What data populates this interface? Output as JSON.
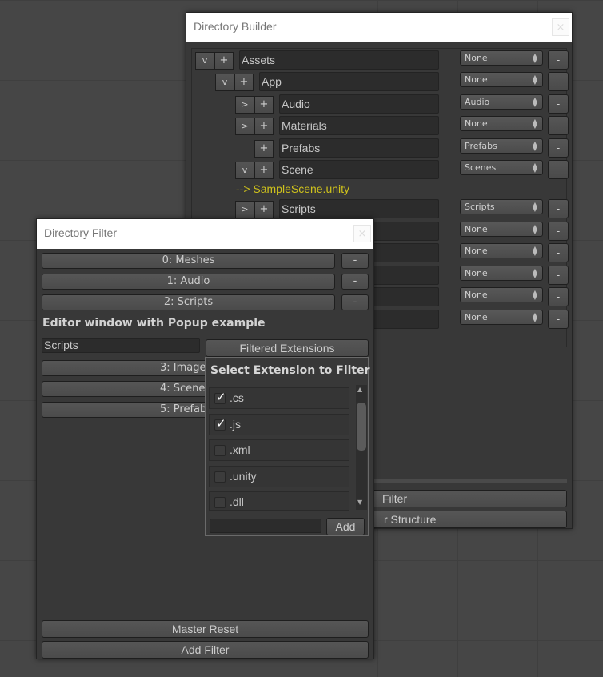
{
  "directory_builder": {
    "title": "Directory Builder",
    "close": "×",
    "tree": [
      {
        "toggle": "v",
        "add": "+",
        "name": "Assets",
        "dropdown": "None",
        "remove": "-"
      },
      {
        "toggle": "v",
        "add": "+",
        "name": "App",
        "dropdown": "None",
        "remove": "-"
      },
      {
        "toggle": ">",
        "add": "+",
        "name": "Audio",
        "dropdown": "Audio",
        "remove": "-"
      },
      {
        "toggle": ">",
        "add": "+",
        "name": "Materials",
        "dropdown": "None",
        "remove": "-"
      },
      {
        "toggle": "",
        "add": "+",
        "name": "Prefabs",
        "dropdown": "Prefabs",
        "remove": "-"
      },
      {
        "toggle": "v",
        "add": "+",
        "name": "Scene",
        "dropdown": "Scenes",
        "remove": "-"
      },
      {
        "toggle": ">",
        "add": "+",
        "name": "Scripts",
        "dropdown": "Scripts",
        "remove": "-"
      }
    ],
    "scene_file": "--> SampleScene.unity",
    "more_dropdowns": [
      "None",
      "None",
      "None",
      "None",
      "None"
    ],
    "remove_label": "-",
    "bottom_button_1": "Filter",
    "bottom_button_2": "r Structure"
  },
  "directory_filter": {
    "title": "Directory Filter",
    "close": "×",
    "filters": [
      {
        "label": "0: Meshes",
        "remove": "-"
      },
      {
        "label": "1: Audio",
        "remove": "-"
      },
      {
        "label": "2: Scripts",
        "remove": "-"
      }
    ],
    "popup_heading": "Editor window with Popup example",
    "name_field": "Scripts",
    "filtered_extensions_button": "Filtered Extensions",
    "more_filters": [
      "3: Image",
      "4: Scene",
      "5: Prefab"
    ],
    "master_reset": "Master Reset",
    "add_filter": "Add Filter"
  },
  "extension_popup": {
    "title": "Select Extension to Filter",
    "items": [
      {
        "label": ".cs",
        "checked": true
      },
      {
        "label": ".js",
        "checked": true
      },
      {
        "label": ".xml",
        "checked": false
      },
      {
        "label": ".unity",
        "checked": false
      },
      {
        "label": ".dll",
        "checked": false
      }
    ],
    "check_glyph": "✓",
    "new_extension_value": "",
    "add_button": "Add",
    "scroll_up": "▲",
    "scroll_down": "▼"
  }
}
